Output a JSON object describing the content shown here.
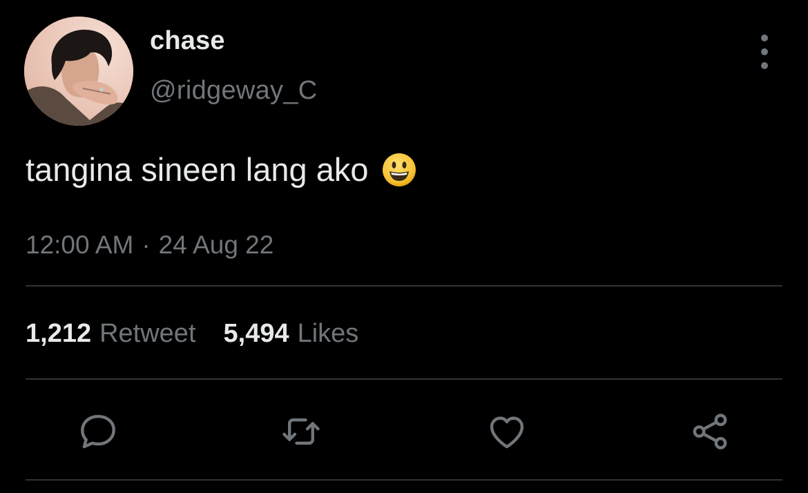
{
  "tweet": {
    "author": {
      "display_name": "chase",
      "handle": "@ridgeway_C",
      "avatar_icon": "profile-photo"
    },
    "text": "tangina sineen lang ako",
    "emoji": "smiling-face-icon",
    "time": "12:00 AM",
    "separator": "·",
    "date": "24 Aug 22",
    "stats": {
      "retweets_count": "1,212",
      "retweets_label": "Retweet",
      "likes_count": "5,494",
      "likes_label": "Likes"
    },
    "actions": [
      {
        "name": "reply",
        "icon": "reply-icon"
      },
      {
        "name": "retweet",
        "icon": "retweet-icon"
      },
      {
        "name": "like",
        "icon": "heart-icon"
      },
      {
        "name": "share",
        "icon": "share-icon"
      }
    ]
  },
  "colors": {
    "background": "#000000",
    "primary_text": "#e7e9ea",
    "secondary_text": "#71767b",
    "divider": "#2f3336",
    "icon": "#71767b"
  }
}
